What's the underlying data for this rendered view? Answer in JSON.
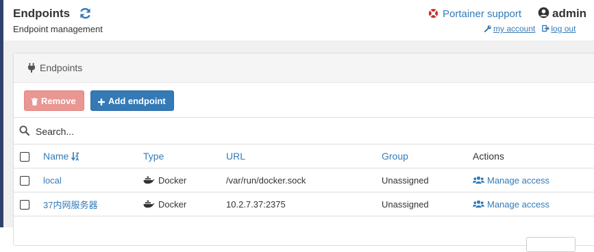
{
  "header": {
    "title": "Endpoints",
    "subtitle": "Endpoint management",
    "support_label": "Portainer support",
    "username": "admin",
    "my_account_label": "my account",
    "log_out_label": "log out"
  },
  "panel": {
    "title": "Endpoints",
    "remove_label": "Remove",
    "add_label": "Add endpoint"
  },
  "search": {
    "placeholder": "Search..."
  },
  "table": {
    "columns": {
      "name": "Name",
      "type": "Type",
      "url": "URL",
      "group": "Group",
      "actions": "Actions"
    },
    "rows": [
      {
        "name": "local",
        "type": "Docker",
        "url": "/var/run/docker.sock",
        "group": "Unassigned",
        "action": "Manage access"
      },
      {
        "name": "37内网服务器",
        "type": "Docker",
        "url": "10.2.7.37:2375",
        "group": "Unassigned",
        "action": "Manage access"
      }
    ]
  },
  "colors": {
    "sidebar": "#30426a",
    "link": "#337ab7",
    "danger": "#e89793",
    "primary": "#337ab7",
    "support_icon": "#c9302c"
  }
}
